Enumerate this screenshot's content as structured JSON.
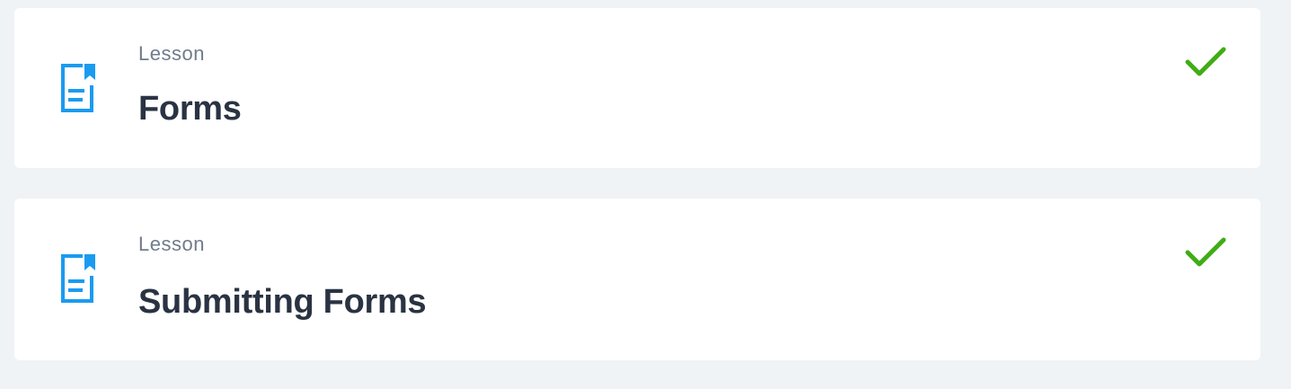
{
  "lessons": [
    {
      "type_label": "Lesson",
      "title": "Forms",
      "icon": "lesson-document-icon",
      "status": "completed",
      "status_icon": "checkmark-icon"
    },
    {
      "type_label": "Lesson",
      "title": "Submitting Forms",
      "icon": "lesson-document-icon",
      "status": "completed",
      "status_icon": "checkmark-icon"
    }
  ],
  "colors": {
    "background": "#f0f3f6",
    "card": "#ffffff",
    "icon_accent": "#1a9bf0",
    "check": "#3fad14",
    "label": "#6f7c8c",
    "title": "#2a3342"
  }
}
